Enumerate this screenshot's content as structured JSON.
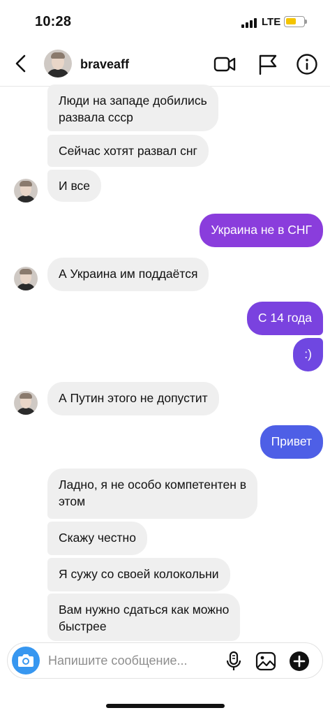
{
  "status_bar": {
    "time": "10:28",
    "network": "LTE",
    "battery_color": "#f4c400"
  },
  "header": {
    "username": "braveaff",
    "icons": [
      "back-icon",
      "video-call-icon",
      "report-flag-icon",
      "info-icon"
    ]
  },
  "colors": {
    "incoming_bubble": "#efefef",
    "outgoing_top": "#8a3ddc",
    "outgoing_bottom": "#4e5fe6",
    "accent": "#3797f0"
  },
  "messages": [
    {
      "direction": "incoming",
      "text": "Люди на западе добились\nразвала ссср"
    },
    {
      "direction": "incoming",
      "text": "Сейчас хотят развал снг"
    },
    {
      "direction": "incoming",
      "text": "И все"
    },
    {
      "direction": "outgoing",
      "text": "Украина не в СНГ"
    },
    {
      "direction": "incoming",
      "text": "А Украина им поддаётся"
    },
    {
      "direction": "outgoing",
      "text": "С 14 года"
    },
    {
      "direction": "outgoing",
      "text": ":)"
    },
    {
      "direction": "incoming",
      "text": "А Путин этого не допустит"
    },
    {
      "direction": "outgoing",
      "text": "Привет"
    },
    {
      "direction": "incoming",
      "text": "Ладно, я не особо компетентен в\nэтом"
    },
    {
      "direction": "incoming",
      "text": "Скажу честно"
    },
    {
      "direction": "incoming",
      "text": "Я сужу со своей колокольни"
    },
    {
      "direction": "incoming",
      "text": "Вам нужно сдаться как можно\nбыстрее"
    }
  ],
  "composer": {
    "placeholder": "Напишите сообщение...",
    "icons": [
      "camera-icon",
      "microphone-icon",
      "gallery-icon",
      "add-icon"
    ]
  }
}
